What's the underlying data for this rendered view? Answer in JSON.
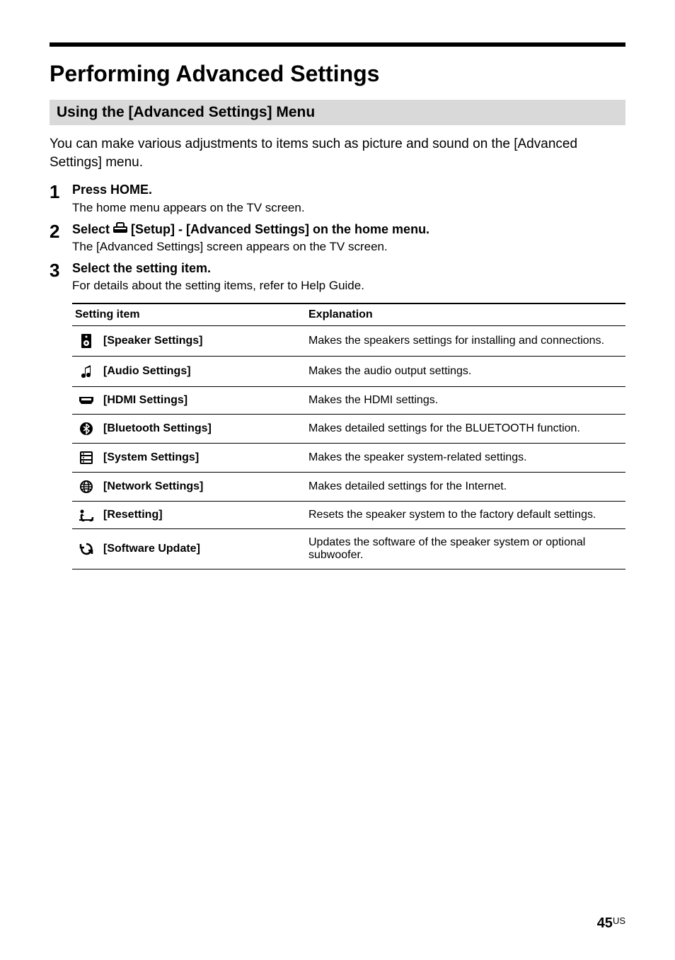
{
  "title": "Performing Advanced Settings",
  "section_header": "Using the [Advanced Settings] Menu",
  "intro": "You can make various adjustments to items such as picture and sound on the [Advanced Settings] menu.",
  "steps": [
    {
      "num": "1",
      "instruction": "Press HOME.",
      "detail": "The home menu appears on the TV screen."
    },
    {
      "num": "2",
      "instruction_prefix": "Select ",
      "instruction_suffix": " [Setup] - [Advanced Settings] on the home menu.",
      "detail": "The [Advanced Settings] screen appears on the TV screen."
    },
    {
      "num": "3",
      "instruction": "Select the setting item.",
      "detail": "For details about the setting items, refer to Help Guide."
    }
  ],
  "table": {
    "headers": {
      "col1": "Setting item",
      "col2": "Explanation"
    },
    "rows": [
      {
        "item": "[Speaker Settings]",
        "explanation": "Makes the speakers settings for installing and connections.",
        "icon": "speaker"
      },
      {
        "item": "[Audio Settings]",
        "explanation": "Makes the audio output settings.",
        "icon": "audio"
      },
      {
        "item": "[HDMI Settings]",
        "explanation": "Makes the HDMI settings.",
        "icon": "hdmi"
      },
      {
        "item": "[Bluetooth Settings]",
        "explanation": "Makes detailed settings for the BLUETOOTH function.",
        "icon": "bluetooth"
      },
      {
        "item": "[System Settings]",
        "explanation": "Makes the speaker system-related settings.",
        "icon": "system"
      },
      {
        "item": "[Network Settings]",
        "explanation": "Makes detailed settings for the Internet.",
        "icon": "network"
      },
      {
        "item": "[Resetting]",
        "explanation": "Resets the speaker system to the factory default settings.",
        "icon": "reset"
      },
      {
        "item": "[Software Update]",
        "explanation": "Updates the software of the speaker system or optional subwoofer.",
        "icon": "update"
      }
    ]
  },
  "page": {
    "num": "45",
    "suffix": "US"
  },
  "icons": {
    "speaker": "speaker-icon",
    "audio": "audio-icon",
    "hdmi": "hdmi-icon",
    "bluetooth": "bluetooth-icon",
    "system": "system-icon",
    "network": "network-icon",
    "reset": "reset-icon",
    "update": "update-icon",
    "setup": "setup-icon"
  }
}
